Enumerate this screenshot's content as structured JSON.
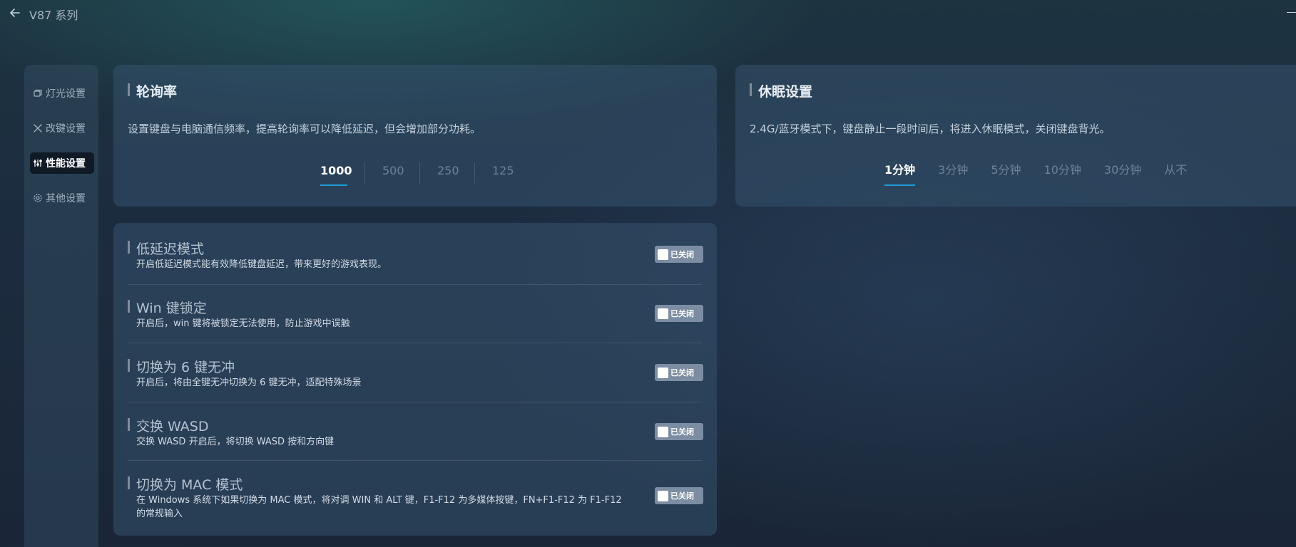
{
  "header": {
    "title": "V87 系列"
  },
  "sidebar": {
    "items": [
      {
        "label": "灯光设置",
        "icon": "lighting-icon",
        "active": false
      },
      {
        "label": "改键设置",
        "icon": "keymap-icon",
        "active": false
      },
      {
        "label": "性能设置",
        "icon": "performance-icon",
        "active": true
      },
      {
        "label": "其他设置",
        "icon": "gear-icon",
        "active": false
      }
    ]
  },
  "polling": {
    "title": "轮询率",
    "description": "设置键盘与电脑通信频率，提高轮询率可以降低延迟，但会增加部分功耗。",
    "options": [
      "1000",
      "500",
      "250",
      "125"
    ],
    "selected": "1000"
  },
  "sleep": {
    "title": "休眠设置",
    "description": "2.4G/蓝牙模式下，键盘静止一段时间后，将进入休眠模式，关闭键盘背光。",
    "options": [
      "1分钟",
      "3分钟",
      "5分钟",
      "10分钟",
      "30分钟",
      "从不"
    ],
    "selected": "1分钟"
  },
  "settings": [
    {
      "name": "低延迟模式",
      "description": "开启低延迟模式能有效降低键盘延迟，带来更好的游戏表现。",
      "toggle_label": "已关闭",
      "enabled": false
    },
    {
      "name": "Win 键锁定",
      "description": "开启后，win 键将被锁定无法使用，防止游戏中误触",
      "toggle_label": "已关闭",
      "enabled": false
    },
    {
      "name": "切换为 6 键无冲",
      "description": "开启后，将由全键无冲切换为 6 键无冲，适配特殊场景",
      "toggle_label": "已关闭",
      "enabled": false
    },
    {
      "name": "交换 WASD",
      "description": "交换 WASD 开启后，将切换 WASD 按和方向键",
      "toggle_label": "已关闭",
      "enabled": false
    },
    {
      "name": "切换为 MAC 模式",
      "description": "在 Windows 系统下如果切换为 MAC 模式，将对调 WIN 和 ALT 键，F1-F12 为多媒体按键，FN+F1-F12 为 F1-F12 的常规输入",
      "toggle_label": "已关闭",
      "enabled": false
    }
  ],
  "colors": {
    "accent": "#1e9fd8",
    "toggle_off": "#7c8da3",
    "active_nav": "#0f1a26"
  }
}
